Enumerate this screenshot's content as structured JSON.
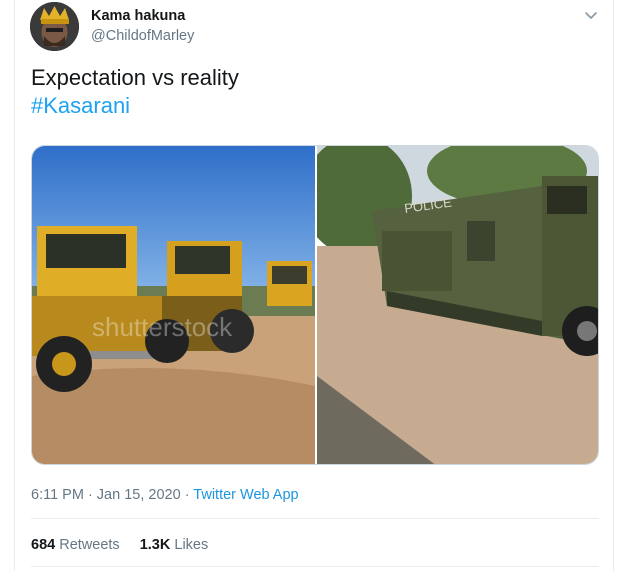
{
  "tweet": {
    "author": {
      "display_name": "Kama hakuna",
      "handle": "@ChildofMarley",
      "avatar_icon": "avatar-image"
    },
    "menu_icon": "chevron-down-icon",
    "text": "Expectation vs reality",
    "hashtag": "#Kasarani",
    "media": {
      "left_label": "shutterstock",
      "right_label": "POLICE"
    },
    "timestamp": "6:11 PM · Jan 15, 2020",
    "separator": " · ",
    "source": "Twitter Web App",
    "stats": {
      "retweets_count": "684",
      "retweets_label": "Retweets",
      "likes_count": "1.3K",
      "likes_label": "Likes"
    }
  },
  "colors": {
    "link": "#1da1f2",
    "secondary_text": "#657786",
    "divider": "#e6ecf0"
  }
}
